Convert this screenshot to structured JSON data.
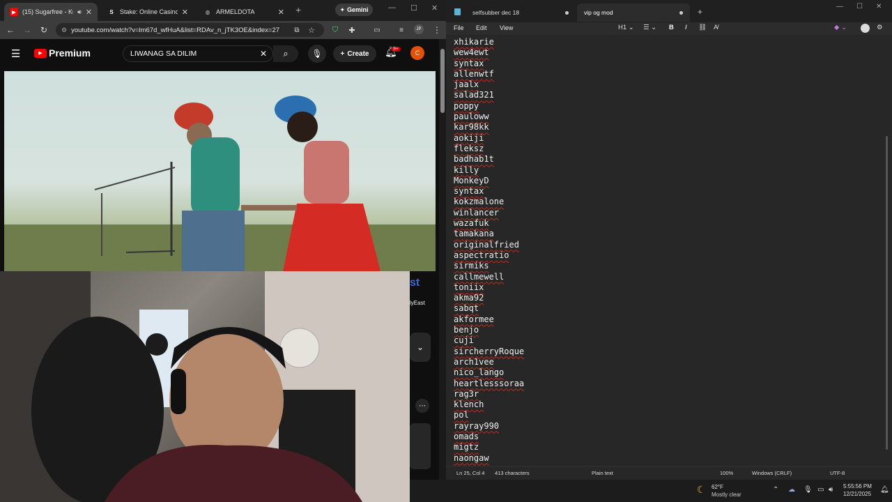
{
  "browser": {
    "tabs": [
      {
        "title": "(15) Sugarfree - Kung",
        "fav": "youtube-icon",
        "active": true
      },
      {
        "title": "Stake: Online Casino & Sp",
        "fav": "stake-icon",
        "active": false
      },
      {
        "title": "ARMELDOTA",
        "fav": "globe-icon",
        "active": false
      }
    ],
    "gemini_label": "Gemini",
    "url": "youtube.com/watch?v=lm67d_wfHuA&list=RDAv_n_jTK3OE&index=27",
    "profile_initials": "JP"
  },
  "youtube": {
    "brand": "Premium",
    "search_value": "LIWANAG SA DILIM",
    "create_label": "Create",
    "notification_count": "9+",
    "channel_initial": "C",
    "watermark": "lyEast"
  },
  "notepad": {
    "tabs": [
      {
        "label": "selfsubber dec 18",
        "active": false
      },
      {
        "label": "vip og mod",
        "active": true
      }
    ],
    "menu": [
      "File",
      "Edit",
      "View"
    ],
    "heading_select": "H1",
    "lines": [
      "xhikarie",
      "wew4ewt",
      "syntax",
      "allenwtf",
      "jaalx",
      "salad321",
      "poppy",
      "pauloww",
      "kar98kk",
      "aokiji",
      "fleksz",
      "badhab1t",
      "killy",
      "MonkeyD",
      "syntax",
      "kokzmalone",
      "winlancer",
      "wazafuk",
      "tamakana",
      "originalfried",
      "aspectratio",
      "sirmiks",
      "callmewell",
      "toniix",
      "akma92",
      "sabqt",
      "akformee",
      "benjo",
      "cuji",
      "sircherryRoque",
      "arch1vee",
      "nico_lango",
      "heartlesssoraa",
      "rag3r",
      "klench",
      "pol",
      "rayray990",
      "omads",
      "migtz",
      "naongaw"
    ],
    "status": {
      "position": "Ln 25, Col 4",
      "chars": "413 characters",
      "format": "Plain text",
      "zoom": "100%",
      "eol": "Windows (CRLF)",
      "encoding": "UTF-8"
    }
  },
  "taskbar": {
    "temp": "62°F",
    "weather": "Mostly clear",
    "time": "5:55:56 PM",
    "date": "12/21/2025"
  }
}
